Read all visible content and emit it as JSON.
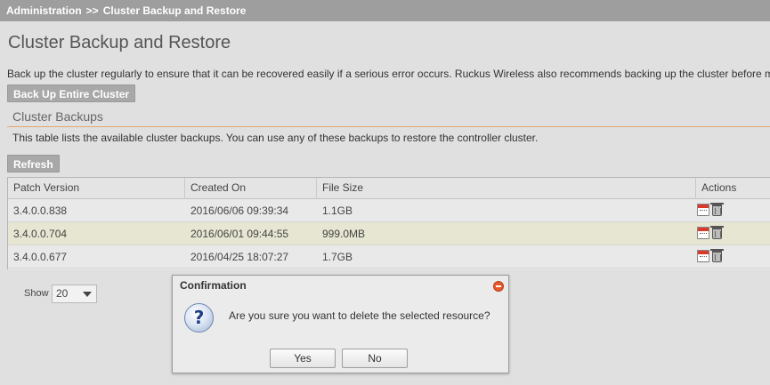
{
  "breadcrumb": {
    "root": "Administration",
    "separator": ">>",
    "current": "Cluster Backup and Restore"
  },
  "page": {
    "title": "Cluster Backup and Restore",
    "intro": "Back up the cluster regularly to ensure that it can be recovered easily if a serious error occurs. Ruckus Wireless also recommends backing up the cluster before m",
    "backup_button": "Back Up Entire Cluster"
  },
  "backups": {
    "title": "Cluster Backups",
    "description": "This table lists the available cluster backups. You can use any of these backups to restore the controller cluster.",
    "refresh_button": "Refresh",
    "columns": [
      "Patch Version",
      "Created On",
      "File Size",
      "Actions"
    ],
    "rows": [
      {
        "version": "3.4.0.0.838",
        "created": "2016/06/06 09:39:34",
        "size": "1.1GB",
        "selected": false
      },
      {
        "version": "3.4.0.0.704",
        "created": "2016/06/01 09:44:55",
        "size": "999.0MB",
        "selected": true
      },
      {
        "version": "3.4.0.0.677",
        "created": "2016/04/25 18:07:27",
        "size": "1.7GB",
        "selected": false
      }
    ],
    "show_label": "Show",
    "show_value": "20"
  },
  "dialog": {
    "title": "Confirmation",
    "icon": "question-icon",
    "icon_glyph": "?",
    "message": "Are you sure you want to delete the selected resource?",
    "yes": "Yes",
    "no": "No"
  },
  "colors": {
    "breadcrumb_bg": "#9e9e9e",
    "selected_row": "#e6e6d2",
    "section_rule": "#e2a76c",
    "close_icon": "#e8582a"
  }
}
